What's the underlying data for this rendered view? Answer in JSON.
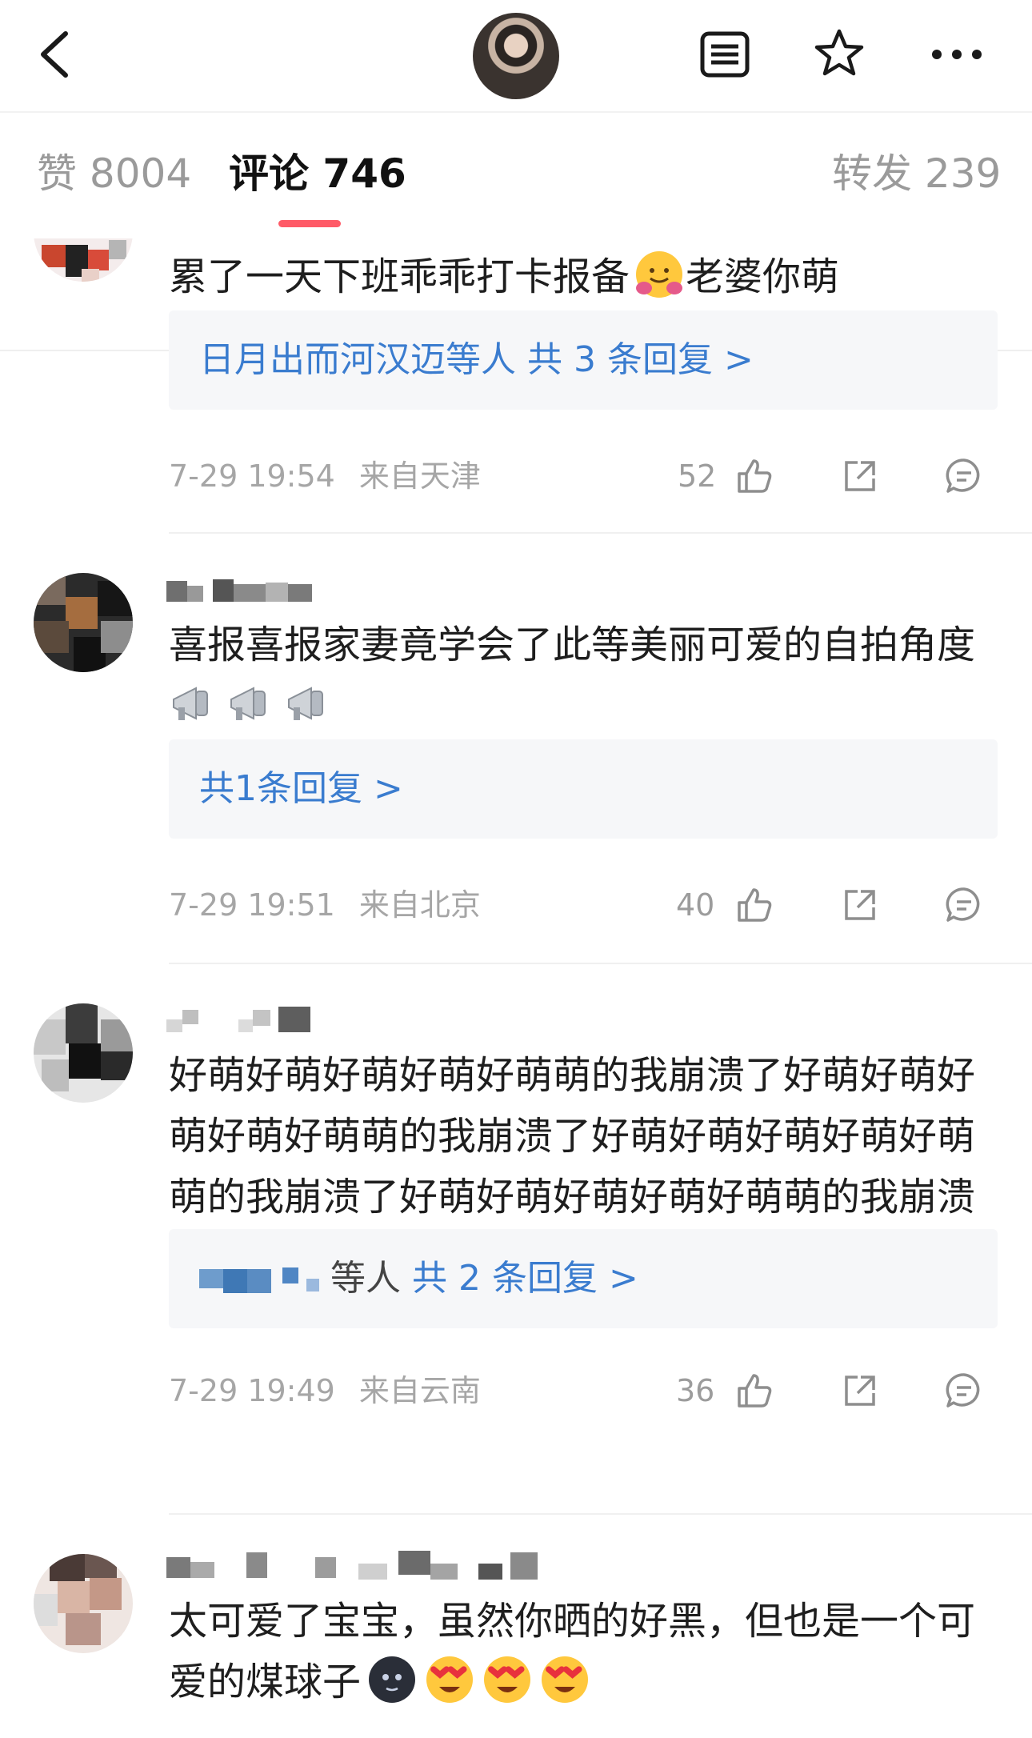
{
  "header": {
    "back_icon": "chevron-left-icon",
    "list_icon": "list-icon",
    "star_icon": "star-icon",
    "more_icon": "more-icon"
  },
  "tabs": {
    "likes": "赞 8004",
    "comments": "评论 746",
    "reposts": "转发 239",
    "active": "comments",
    "indicator_color": "#ff5a67"
  },
  "comments": [
    {
      "text": "累了一天下班乖乖打卡报备",
      "text_after_emoji": "老婆你萌",
      "reply_users": "日月出而河汉迈等人",
      "reply_more": "共 3 条回复 >",
      "time": "7-29 19:54",
      "location": "来自天津",
      "likes": "52"
    },
    {
      "text": "喜报喜报家妻竟学会了此等美丽可爱的自拍角度",
      "reply_more": "共1条回复 >",
      "time": "7-29 19:51",
      "location": "来自北京",
      "likes": "40"
    },
    {
      "text": "好萌好萌好萌好萌好萌萌的我崩溃了好萌好萌好萌好萌好萌萌的我崩溃了好萌好萌好萌好萌好萌萌的我崩溃了好萌好萌好萌好萌好萌萌的我崩溃了",
      "reply_users": "等人",
      "reply_more": "共 2 条回复 >",
      "time": "7-29 19:49",
      "location": "来自云南",
      "likes": "36"
    },
    {
      "text": "太可爱了宝宝，虽然你晒的好黑，但也是一个可爱的煤球子"
    }
  ],
  "colors": {
    "link": "#3a7ccf",
    "meta_gray": "#a6a6a6",
    "reply_bg": "#f6f7f9"
  }
}
